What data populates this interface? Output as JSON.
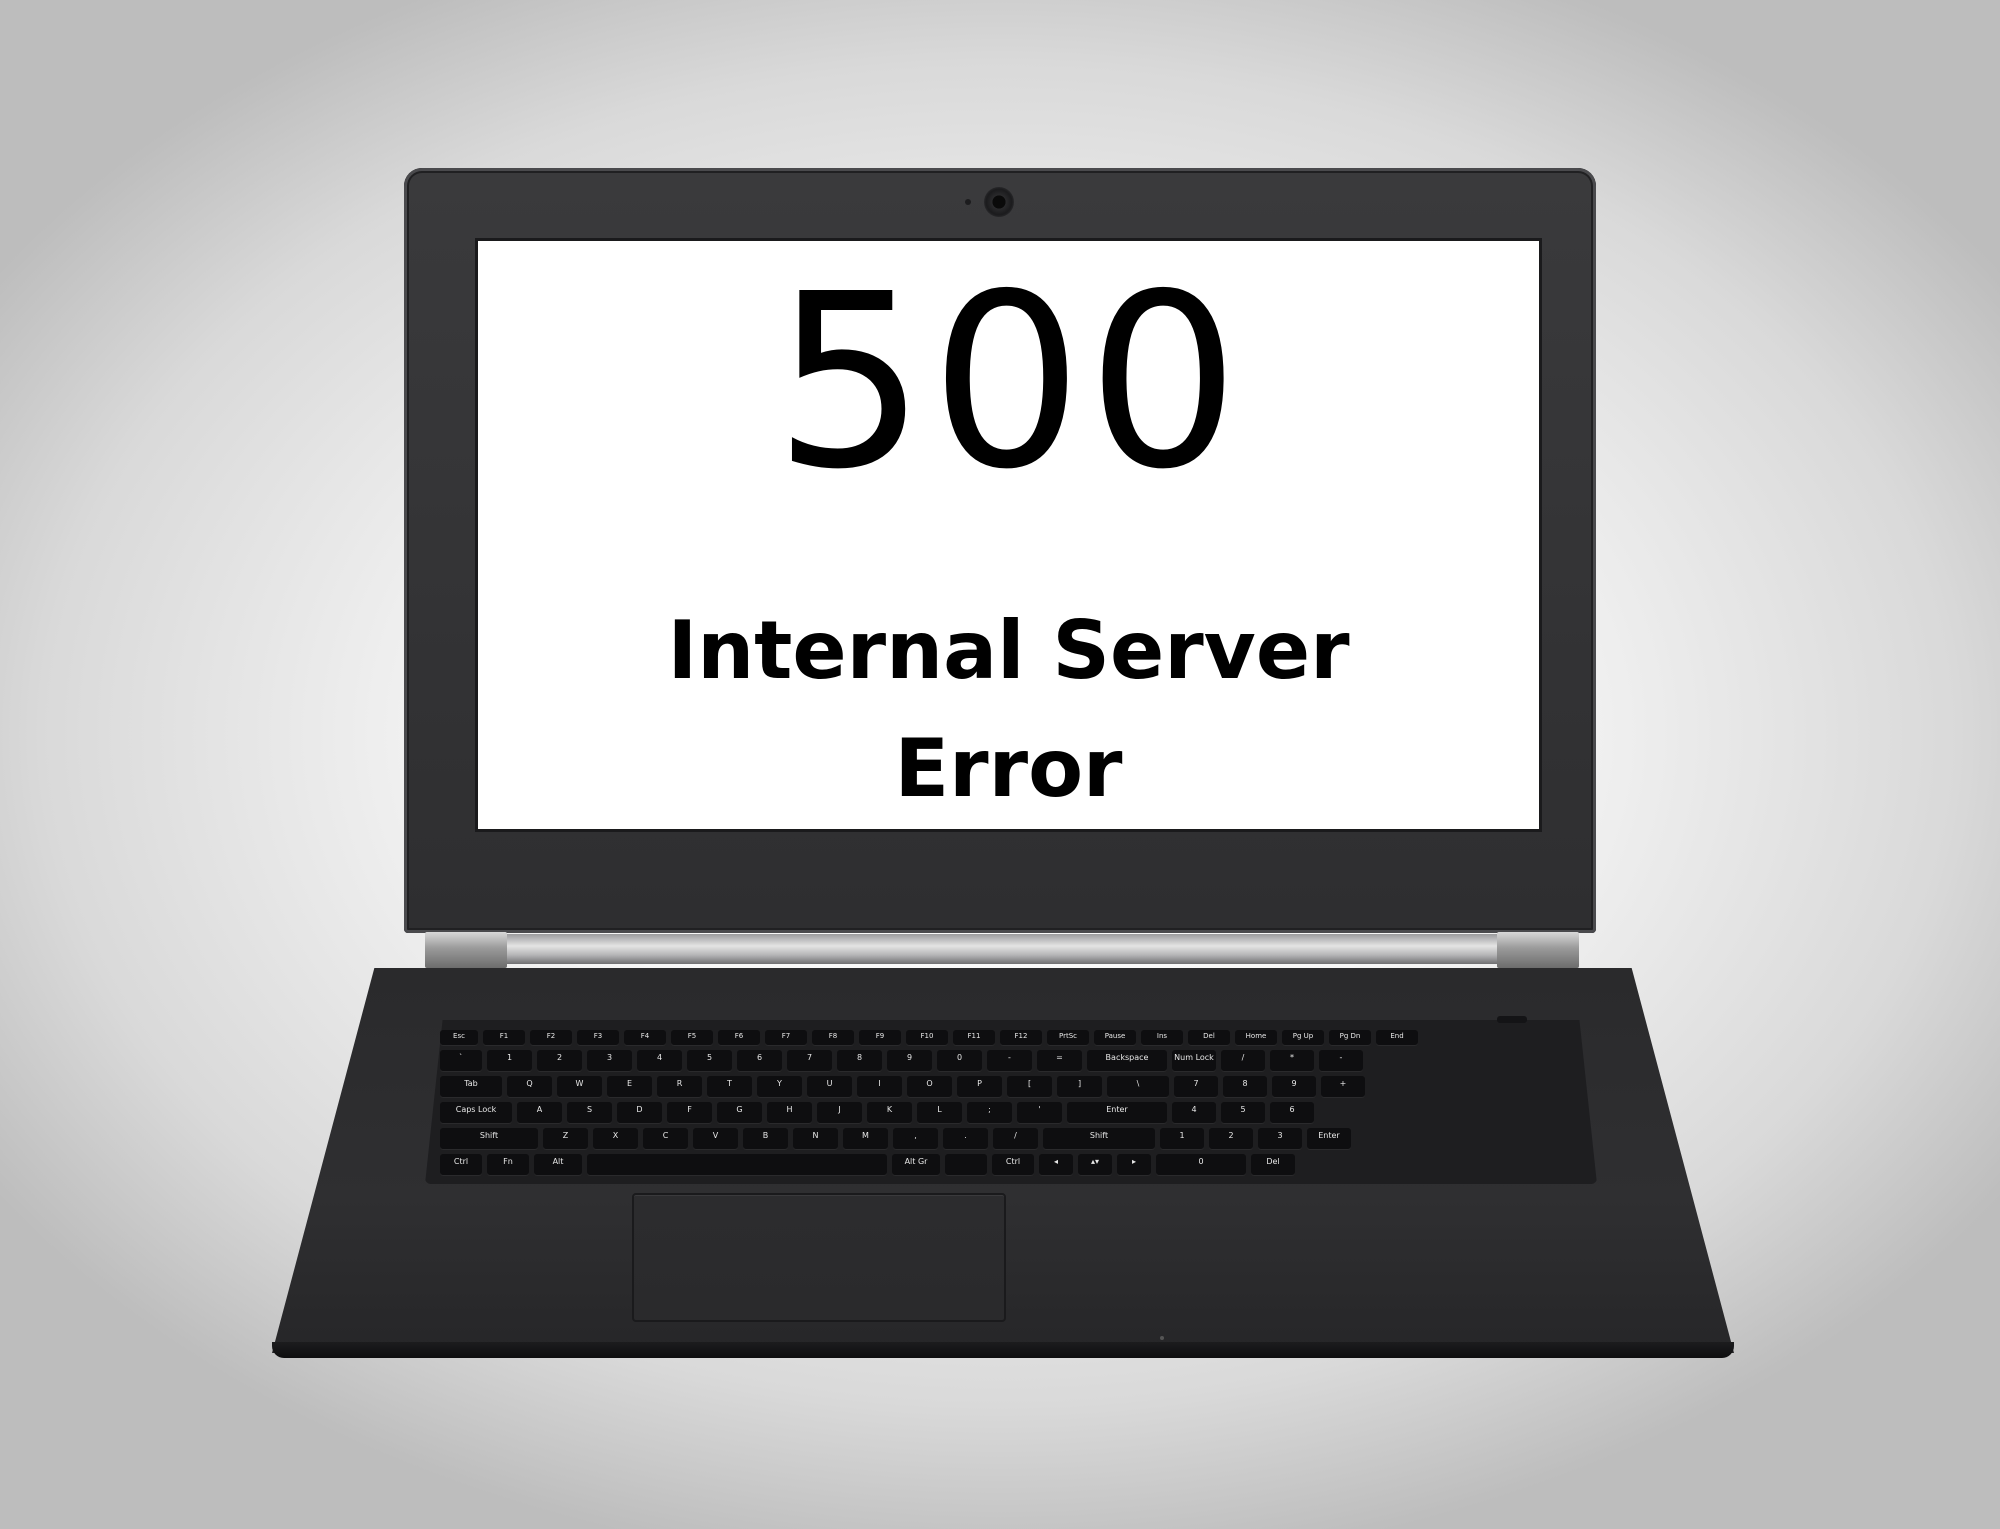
{
  "screen": {
    "code": "500",
    "message_line1": "Internal Server",
    "message_line2": "Error"
  },
  "keyboard": {
    "row_fn": [
      "Esc",
      "F1",
      "F2",
      "F3",
      "F4",
      "F5",
      "F6",
      "F7",
      "F8",
      "F9",
      "F10",
      "F11",
      "F12",
      "PrtSc",
      "Pause",
      "Ins",
      "Del",
      "Home",
      "Pg Up",
      "Pg Dn",
      "End"
    ],
    "row_num": [
      "`",
      "1",
      "2",
      "3",
      "4",
      "5",
      "6",
      "7",
      "8",
      "9",
      "0",
      "-",
      "=",
      "Backspace",
      "Num Lock",
      "/",
      "*",
      "-"
    ],
    "row_q": [
      "Tab",
      "Q",
      "W",
      "E",
      "R",
      "T",
      "Y",
      "U",
      "I",
      "O",
      "P",
      "[",
      "]",
      "\\",
      "7",
      "8",
      "9",
      "+"
    ],
    "row_a": [
      "Caps Lock",
      "A",
      "S",
      "D",
      "F",
      "G",
      "H",
      "J",
      "K",
      "L",
      ";",
      "'",
      "Enter",
      "4",
      "5",
      "6"
    ],
    "row_z": [
      "Shift",
      "Z",
      "X",
      "C",
      "V",
      "B",
      "N",
      "M",
      ",",
      ".",
      "/",
      "Shift",
      "1",
      "2",
      "3",
      "Enter"
    ],
    "row_space": [
      "Ctrl",
      "Fn",
      "Alt",
      "",
      "Alt Gr",
      "",
      "Ctrl",
      "◂",
      "▴▾",
      "▸",
      "0",
      "Del"
    ]
  },
  "colors": {
    "body": "#2e2e30",
    "screen": "#ffffff",
    "key": "#0e0e10"
  }
}
